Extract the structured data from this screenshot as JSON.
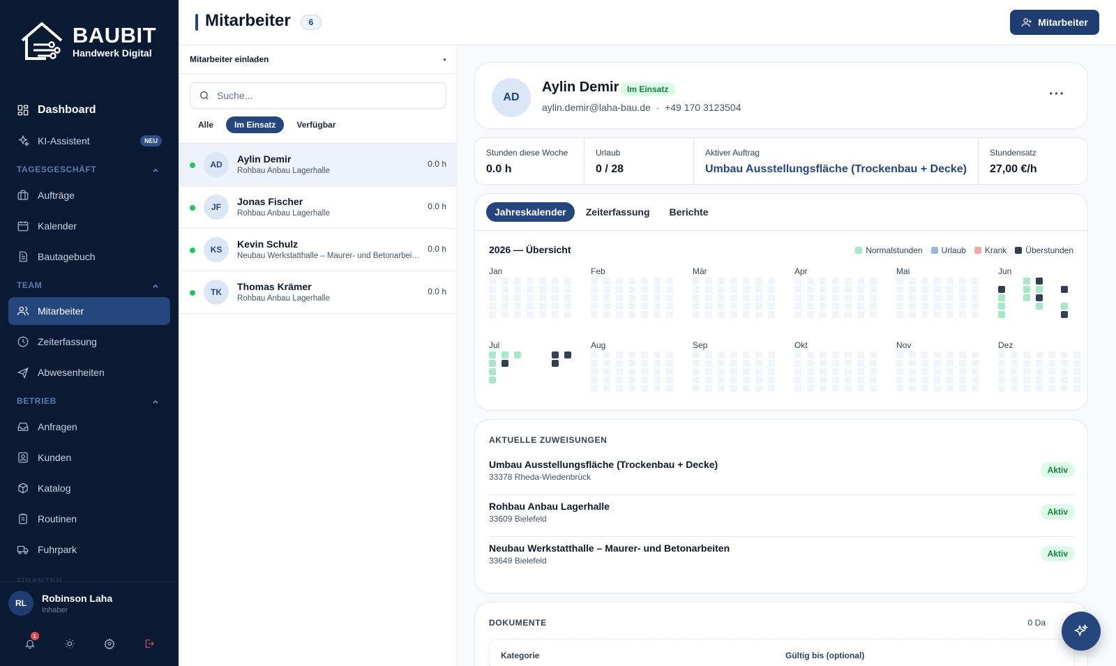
{
  "brand": {
    "name": "BAUBIT",
    "tagline": "Handwerk Digital"
  },
  "sidebar": {
    "dashboard": "Dashboard",
    "ki": {
      "label": "KI-Assistent",
      "badge": "NEU"
    },
    "sections": [
      {
        "title": "TAGESGESCHÄFT",
        "items": [
          "Aufträge",
          "Kalender",
          "Bautagebuch"
        ]
      },
      {
        "title": "TEAM",
        "items": [
          "Mitarbeiter",
          "Zeiterfassung",
          "Abwesenheiten"
        ]
      },
      {
        "title": "BETRIEB",
        "items": [
          "Anfragen",
          "Kunden",
          "Katalog",
          "Routinen",
          "Fuhrpark"
        ]
      }
    ],
    "next_section": "FINANZEN",
    "user": {
      "initials": "RL",
      "name": "Robinson Laha",
      "role": "Inhaber"
    },
    "notifications": "1"
  },
  "header": {
    "title": "Mitarbeiter",
    "count": "6",
    "add_button": "Mitarbeiter"
  },
  "list": {
    "invite": "Mitarbeiter einladen",
    "search_placeholder": "Suche...",
    "filters": [
      "Alle",
      "Im Einsatz",
      "Verfügbar"
    ],
    "employees": [
      {
        "initials": "AD",
        "name": "Aylin Demir",
        "project": "Rohbau Anbau Lagerhalle",
        "hours": "0.0 h"
      },
      {
        "initials": "JF",
        "name": "Jonas Fischer",
        "project": "Rohbau Anbau Lagerhalle",
        "hours": "0.0 h"
      },
      {
        "initials": "KS",
        "name": "Kevin Schulz",
        "project": "Neubau Werkstatthalle – Maurer- und Betonarbeiten",
        "hours": "0.0 h"
      },
      {
        "initials": "TK",
        "name": "Thomas Krämer",
        "project": "Rohbau Anbau Lagerhalle",
        "hours": "0.0 h"
      }
    ]
  },
  "profile": {
    "initials": "AD",
    "name": "Aylin Demir",
    "status": "Im Einsatz",
    "email": "aylin.demir@laha-bau.de",
    "phone": "+49 170 3123504",
    "more": "···"
  },
  "stats": [
    {
      "label": "Stunden diese Woche",
      "value": "0.0 h"
    },
    {
      "label": "Urlaub",
      "value": "0 / 28"
    },
    {
      "label": "Aktiver Auftrag",
      "value": "Umbau Ausstellungsfläche (Trockenbau + Decke)"
    },
    {
      "label": "Stundensatz",
      "value": "27,00 €/h"
    }
  ],
  "calendar": {
    "tabs": [
      "Jahreskalender",
      "Zeiterfassung",
      "Berichte"
    ],
    "title": "2026 — Übersicht",
    "legend": [
      {
        "label": "Normalstunden",
        "color": "#a7e8c8"
      },
      {
        "label": "Urlaub",
        "color": "#9bb5e6"
      },
      {
        "label": "Krank",
        "color": "#f4a9a9"
      },
      {
        "label": "Überstunden",
        "color": "#334155"
      }
    ],
    "months": [
      "Jan",
      "Feb",
      "Mär",
      "Apr",
      "Mai",
      "Jun",
      "Jul",
      "Aug",
      "Sep",
      "Okt",
      "Nov",
      "Dez"
    ]
  },
  "assignments": {
    "title": "AKTUELLE ZUWEISUNGEN",
    "items": [
      {
        "title": "Umbau Ausstellungsfläche (Trockenbau + Decke)",
        "address": "33378 Rheda-Wiedenbrück",
        "status": "Aktiv"
      },
      {
        "title": "Rohbau Anbau Lagerhalle",
        "address": "33609 Bielefeld",
        "status": "Aktiv"
      },
      {
        "title": "Neubau Werkstatthalle – Maurer- und Betonarbeiten",
        "address": "33649 Bielefeld",
        "status": "Aktiv"
      }
    ]
  },
  "documents": {
    "title": "DOKUMENTE",
    "count": "0 Da",
    "col_category": "Kategorie",
    "col_valid": "Gültig bis (optional)"
  }
}
